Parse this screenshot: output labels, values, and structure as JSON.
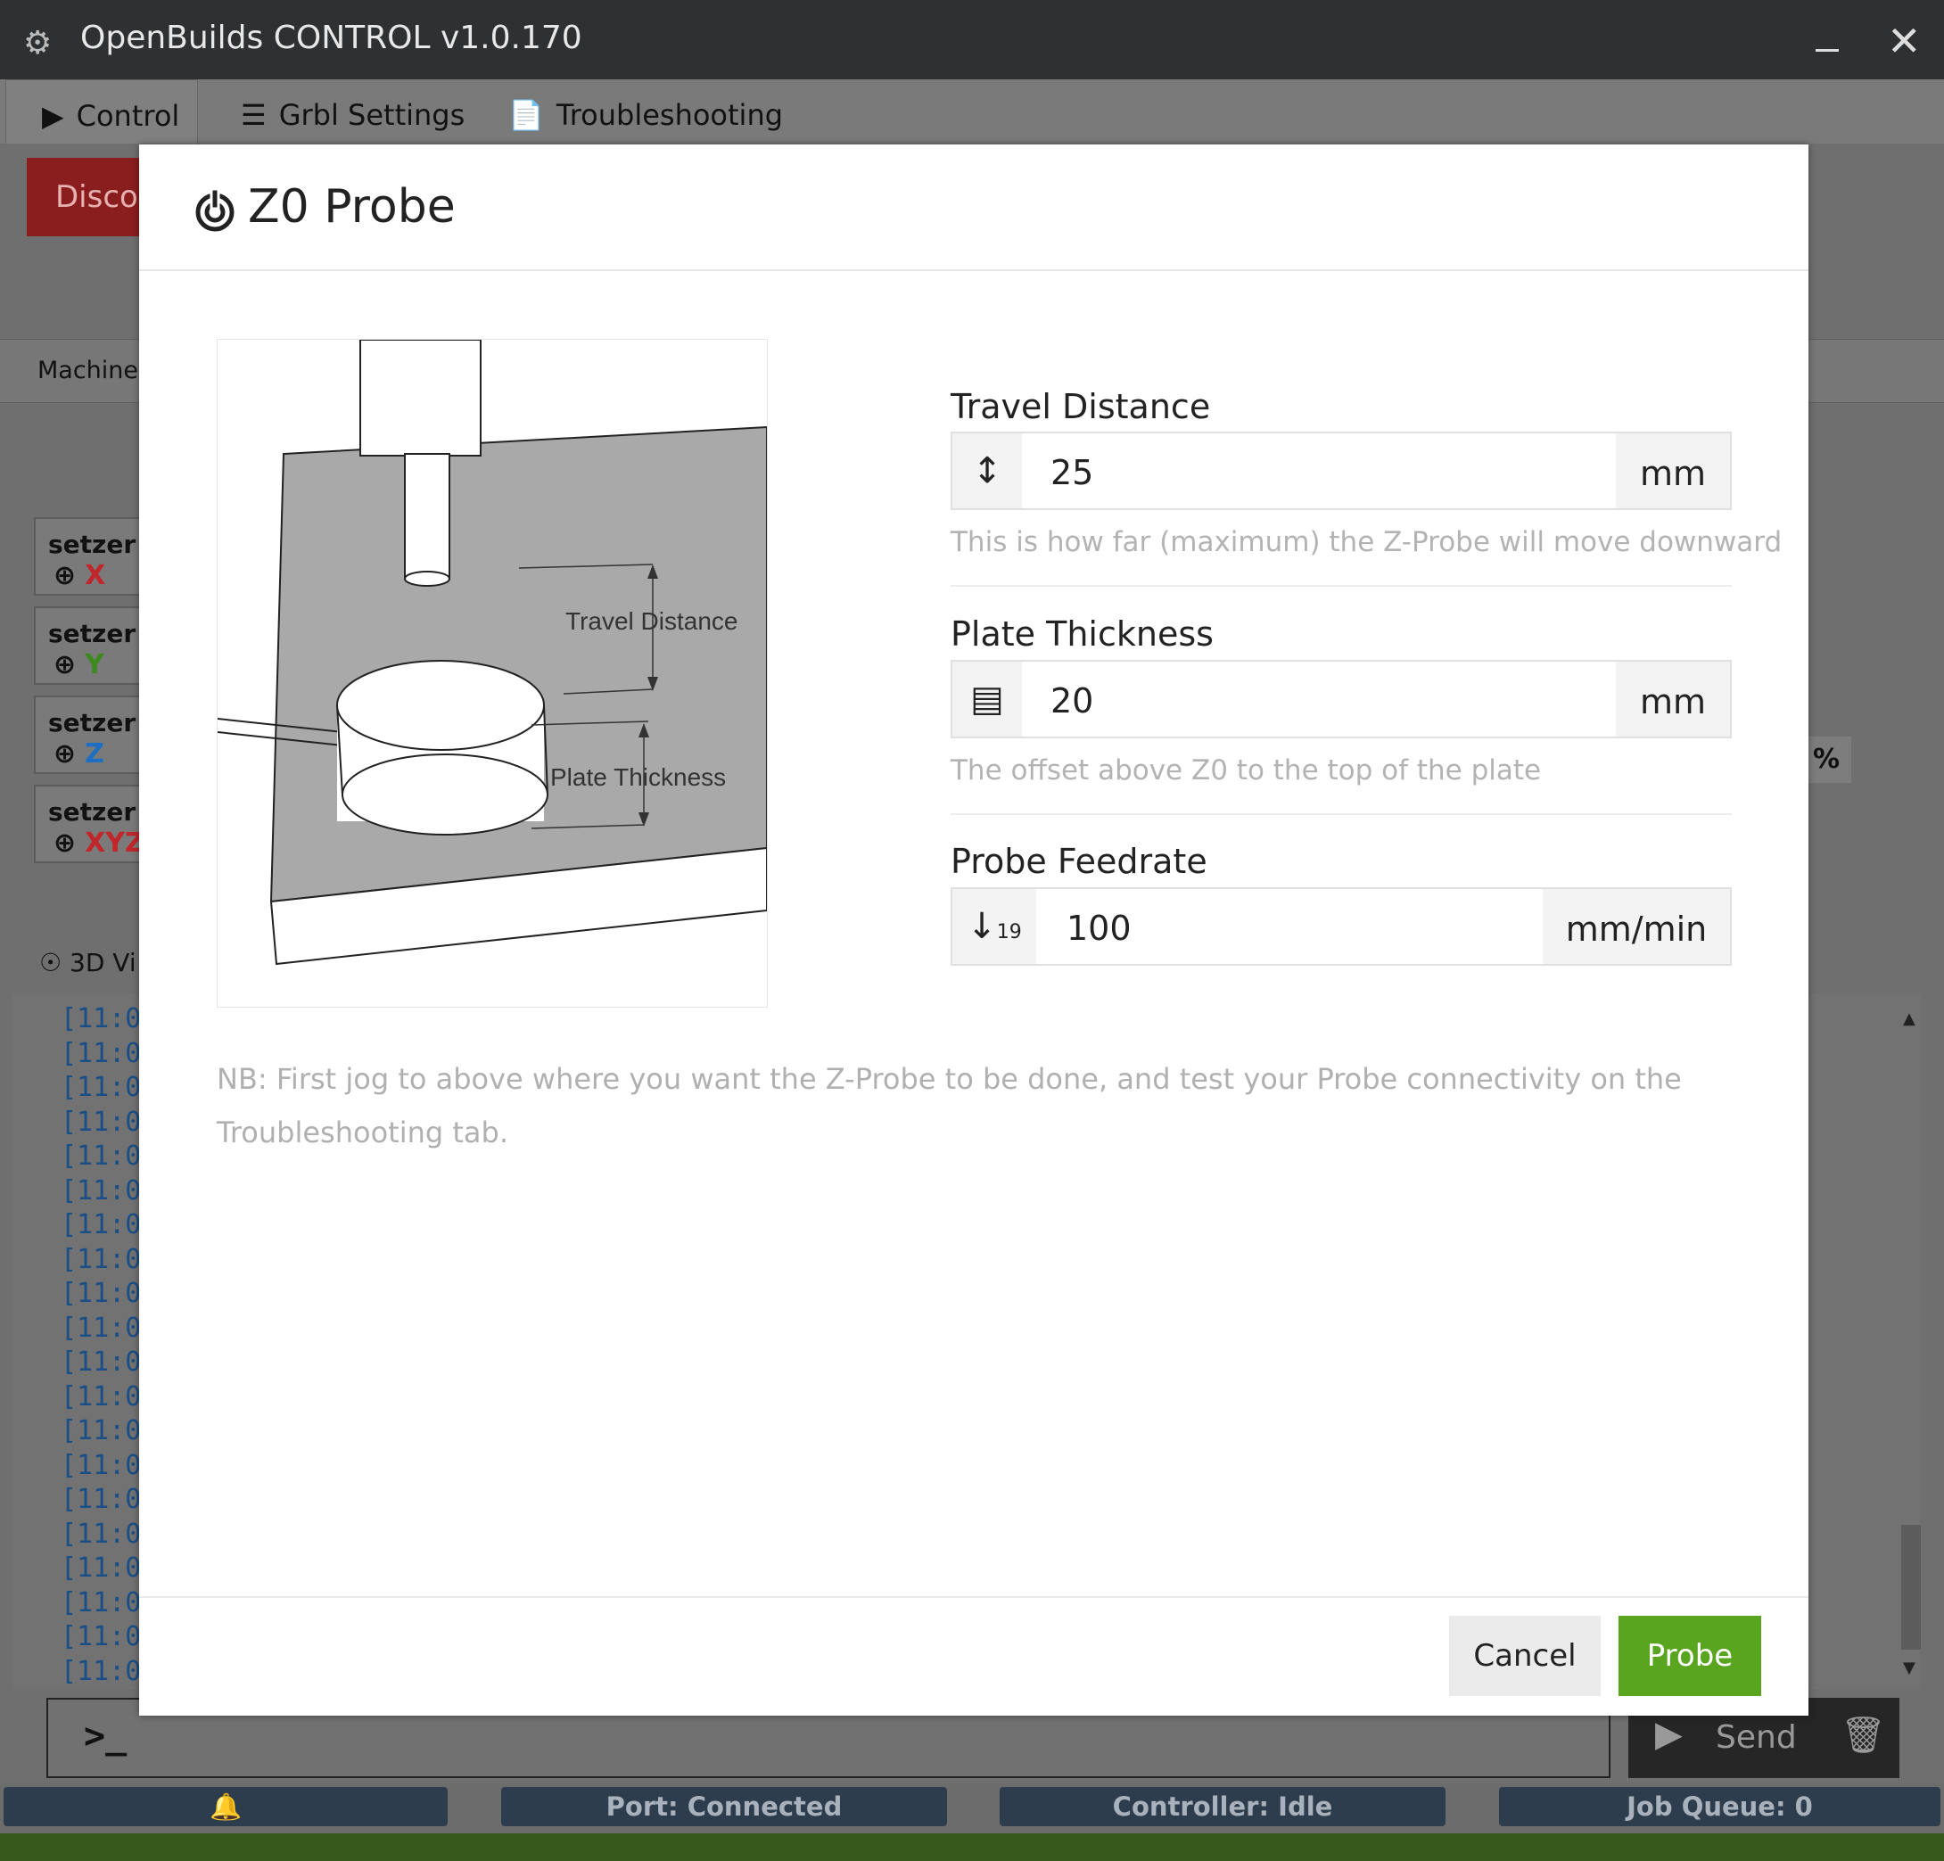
{
  "window": {
    "title": "OpenBuilds CONTROL v1.0.170"
  },
  "tabs": [
    {
      "label": "Control",
      "icon": "play-icon"
    },
    {
      "label": "Grbl Settings",
      "icon": "sliders-icon"
    },
    {
      "label": "Troubleshooting",
      "icon": "file-pulse-icon"
    }
  ],
  "background": {
    "disconnect_label": "Disco",
    "machine_label": "Machine",
    "setzero": [
      {
        "label": "setzer",
        "axis": "X",
        "color": "#c0262a"
      },
      {
        "label": "setzer",
        "axis": "Y",
        "color": "#3d8a1e"
      },
      {
        "label": "setzer",
        "axis": "Z",
        "color": "#1d6fc4"
      },
      {
        "label": "setzer",
        "axis": "XYZ",
        "color": "#c0262a"
      }
    ],
    "viewer_label": "3D Vi",
    "console_lines": [
      "[11:0",
      "[11:0",
      "[11:0",
      "[11:0",
      "[11:0",
      "[11:0",
      "[11:0",
      "[11:0",
      "[11:0",
      "[11:0",
      "[11:0",
      "[11:0",
      "[11:0",
      "[11:0",
      "[11:0",
      "[11:0",
      "[11:0",
      "[11:0",
      "[11:0",
      "[11:0"
    ],
    "percent_badge": "%",
    "prompt": ">_",
    "send_label": "Send"
  },
  "statusbar": {
    "port": "Port: Connected",
    "controller": "Controller: Idle",
    "queue": "Job Queue: 0"
  },
  "modal": {
    "title": "Z0 Probe",
    "image_labels": {
      "travel": "Travel Distance",
      "plate": "Plate Thickness"
    },
    "fields": {
      "travel": {
        "label": "Travel Distance",
        "value": "25",
        "unit": "mm",
        "help": "This is how far (maximum) the Z-Probe will move downward"
      },
      "plate": {
        "label": "Plate Thickness",
        "value": "20",
        "unit": "mm",
        "help": "The offset above Z0 to the top of the plate"
      },
      "feed": {
        "label": "Probe Feedrate",
        "value": "100",
        "unit": "mm/min"
      }
    },
    "note": "NB: First jog to above where you want the Z-Probe to be done, and test your Probe connectivity on the Troubleshooting tab.",
    "cancel_label": "Cancel",
    "probe_label": "Probe"
  },
  "colors": {
    "probe_button": "#5aa520",
    "titlebar": "#2f3032",
    "status_pill": "#2d3d4e"
  }
}
